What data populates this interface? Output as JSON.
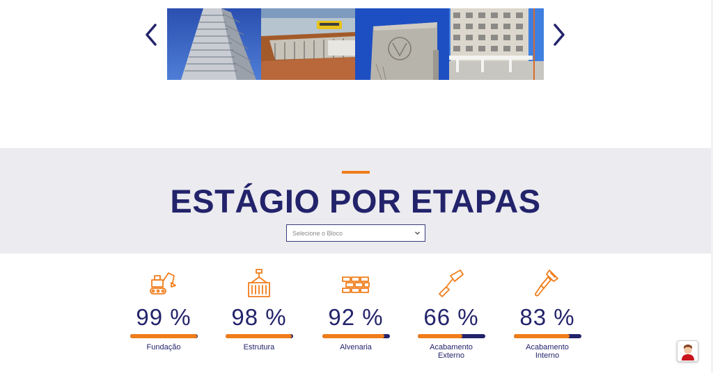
{
  "carousel": {
    "prev_label": "‹",
    "next_label": "›",
    "slides": [
      {
        "name": "tower-photo"
      },
      {
        "name": "excavation-photo"
      },
      {
        "name": "concrete-wall-photo"
      },
      {
        "name": "building-facade-photo"
      }
    ]
  },
  "section": {
    "title": "ESTÁGIO POR ETAPAS",
    "select_placeholder": "Selecione o Bloco"
  },
  "stats": [
    {
      "icon": "excavator-icon",
      "percent": "99 %",
      "value": 99,
      "label": "Fundação"
    },
    {
      "icon": "crane-container-icon",
      "percent": "98 %",
      "value": 98,
      "label": "Estrutura"
    },
    {
      "icon": "bricks-icon",
      "percent": "92 %",
      "value": 92,
      "label": "Alvenaria"
    },
    {
      "icon": "trowel-icon",
      "percent": "66 %",
      "value": 66,
      "label": "Acabamento Externo"
    },
    {
      "icon": "paintbrush-icon",
      "percent": "83 %",
      "value": 83,
      "label": "Acabamento Interno"
    }
  ],
  "colors": {
    "accent": "#f07d1a",
    "primary": "#23236b",
    "section_bg": "#ebebf0"
  }
}
